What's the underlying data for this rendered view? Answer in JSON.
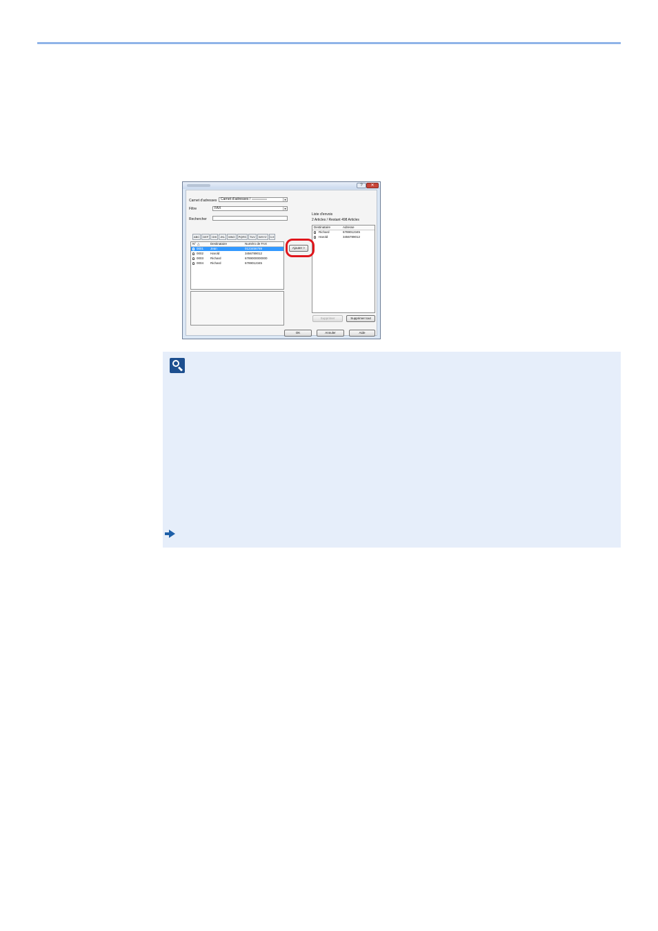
{
  "dialog": {
    "title_bar": {
      "help_glyph": "?",
      "close_glyph": "✕"
    },
    "address_book": {
      "label": "Carnet d'adresses",
      "value": "Carnet d'adresses /"
    },
    "filter": {
      "label": "Filtre",
      "value": "FAX"
    },
    "search": {
      "label": "Rechercher",
      "value": ""
    },
    "tabs": [
      "ABC",
      "DEF",
      "GHI",
      "JKL",
      "MNO",
      "PQRS",
      "TUV",
      "WXYZ",
      "0-9"
    ],
    "left_list": {
      "columns": [
        "N°",
        "Destinataire",
        "Numéro de FAX"
      ],
      "rows": [
        {
          "no": "0001",
          "name": "Jean",
          "fax": "0123456789"
        },
        {
          "no": "0002",
          "name": "Harold",
          "fax": "3456789012"
        },
        {
          "no": "0003",
          "name": "Richard",
          "fax": "6789000000000"
        },
        {
          "no": "0004",
          "name": "Richard",
          "fax": "6789012345"
        }
      ]
    },
    "add_button": "Ajouter >",
    "dest_list": {
      "label": "Liste d'envois",
      "count": "2 Articles / Restant 498 Articles",
      "columns": [
        "Destinataire",
        "Adresse"
      ],
      "rows": [
        {
          "name": "Richard",
          "address": "6789012345"
        },
        {
          "name": "Harold",
          "address": "3456789012"
        }
      ]
    },
    "delete_button": "Supprimer",
    "delete_all_button": "Supprimer tout",
    "ok_button": "OK",
    "cancel_button": "Annuler",
    "help_button": "Aide"
  }
}
